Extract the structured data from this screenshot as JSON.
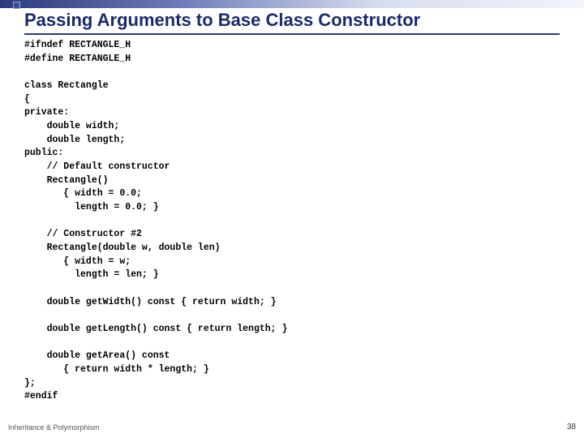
{
  "slide": {
    "title": "Passing Arguments to Base Class Constructor",
    "code": "#ifndef RECTANGLE_H\n#define RECTANGLE_H\n\nclass Rectangle\n{\nprivate:\n    double width;\n    double length;\npublic:\n    // Default constructor\n    Rectangle()\n       { width = 0.0;\n         length = 0.0; }\n\n    // Constructor #2\n    Rectangle(double w, double len)\n       { width = w;\n         length = len; }\n\n    double getWidth() const { return width; }\n\n    double getLength() const { return length; }\n\n    double getArea() const\n       { return width * length; }\n};\n#endif",
    "footer_left": "Inheritance & Polymorphism",
    "footer_right": "38"
  }
}
